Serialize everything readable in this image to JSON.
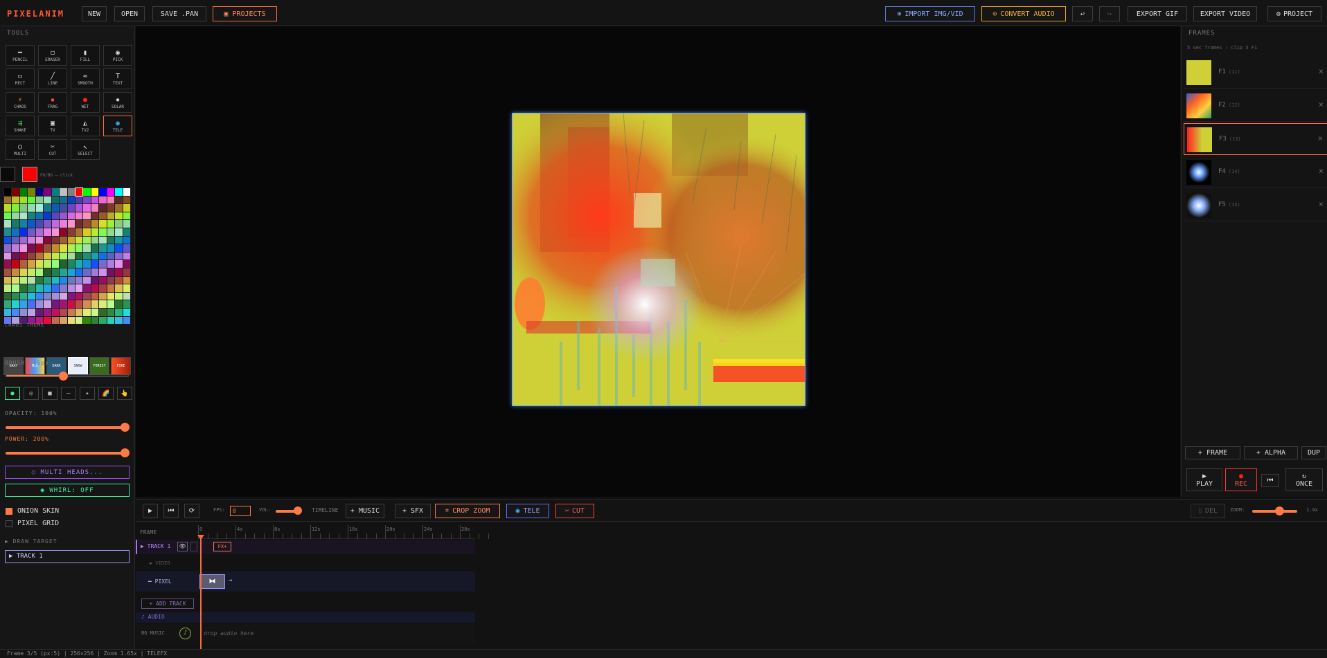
{
  "app": {
    "logo": "PIXELANIM"
  },
  "topbar": {
    "new": "NEW",
    "open": "OPEN",
    "save": "SAVE .PAN",
    "projects": "PROJECTS",
    "import": "IMPORT IMG/VID",
    "convert_audio": "CONVERT AUDIO",
    "export_gif": "EXPORT GIF",
    "export_video": "EXPORT VIDEO",
    "project": "PROJECT"
  },
  "tools": {
    "title": "TOOLS",
    "items": [
      {
        "label": "PENCIL",
        "glyph": "━"
      },
      {
        "label": "ERASER",
        "glyph": "◻"
      },
      {
        "label": "FILL",
        "glyph": "▮"
      },
      {
        "label": "PICK",
        "glyph": "◉"
      },
      {
        "label": "RECT",
        "glyph": "▭"
      },
      {
        "label": "LINE",
        "glyph": "╱"
      },
      {
        "label": "SMOOTH",
        "glyph": "≈"
      },
      {
        "label": "TEXT",
        "glyph": "T"
      },
      {
        "label": "CHAOS",
        "glyph": "⚡"
      },
      {
        "label": "FRAG",
        "glyph": "▪"
      },
      {
        "label": "WET",
        "glyph": "●"
      },
      {
        "label": "SOLAR",
        "glyph": "✹"
      },
      {
        "label": "SHAKE",
        "glyph": "⇶"
      },
      {
        "label": "TV",
        "glyph": "▣"
      },
      {
        "label": "TV2",
        "glyph": "◭"
      },
      {
        "label": "TELE",
        "glyph": "◉"
      },
      {
        "label": "MULTI",
        "glyph": "○"
      },
      {
        "label": "CUT",
        "glyph": "✂"
      },
      {
        "label": "SELECT",
        "glyph": "↖"
      }
    ],
    "active": "TELE"
  },
  "colors": {
    "fg": "#ff0000",
    "bg": "#000000",
    "label": "FG/BG — click",
    "accent": "#ff6a3a"
  },
  "chaos_theme": {
    "title": "CHAOS THEME",
    "themes": [
      "GRAY",
      "MIX",
      "DARK",
      "SNOW",
      "FOREST",
      "FIRE"
    ],
    "active": "SNOW"
  },
  "brush": {
    "label": "BRUSH: 15px",
    "value": 15
  },
  "shapes": [
    "●",
    "◎",
    "■",
    "—",
    "✦",
    "🌈",
    "👆"
  ],
  "opacity": {
    "label": "OPACITY: 100%",
    "value": 100
  },
  "power": {
    "label": "POWER: 200%",
    "value": 200
  },
  "multi_heads": "○ MULTI HEADS...",
  "whirl": "◉ WHIRL: OFF",
  "onion_skin": "ONION SKIN",
  "pixel_grid": "PIXEL GRID",
  "draw_target": {
    "title": "▶ DRAW TARGET",
    "value": "▶ TRACK 1"
  },
  "frames": {
    "title": "FRAMES",
    "subtitle": "5 sec frames : clip 5 F1",
    "items": [
      {
        "label": "F1",
        "num": "(11)"
      },
      {
        "label": "F2",
        "num": "(12)"
      },
      {
        "label": "F3",
        "num": "(13)"
      },
      {
        "label": "F4",
        "num": "(14)"
      },
      {
        "label": "F5",
        "num": "(15)"
      }
    ],
    "active": 2,
    "add_frame": "+ FRAME",
    "add_alpha": "+ ALPHA",
    "dup": "DUP",
    "play": "PLAY",
    "rec": "REC",
    "once": "ONCE"
  },
  "btoolbar": {
    "fps_label": "FPS:",
    "fps_value": "8",
    "vol_label": "VOL:",
    "timeline": "TIMELINE",
    "music": "+ MUSIC",
    "sfx": "+ SFX",
    "crop_zoom": "CROP ZOOM",
    "tele": "TELE",
    "cut": "CUT",
    "del": "DEL",
    "zoom_label": "ZOOM:",
    "zoom_value": "1.4x",
    "zoom_level": 0.6
  },
  "timeline": {
    "frame_label": "FRAME",
    "ticks": [
      "0",
      "4s",
      "8s",
      "12s",
      "16s",
      "20s",
      "24s",
      "28s"
    ],
    "track1": "▶ TRACK 1",
    "fx": "FX+",
    "video": "▶ VIDEO",
    "pixel": "━ PIXEL",
    "add_track": "+ ADD TRACK",
    "audio": "♪ AUDIO",
    "bg_music": "BG MUSIC",
    "drop_audio": "drop audio here"
  },
  "statusbar": "Frame 3/5 (px:5) | 256×256 | Zoom 1.65x | TELEFX"
}
